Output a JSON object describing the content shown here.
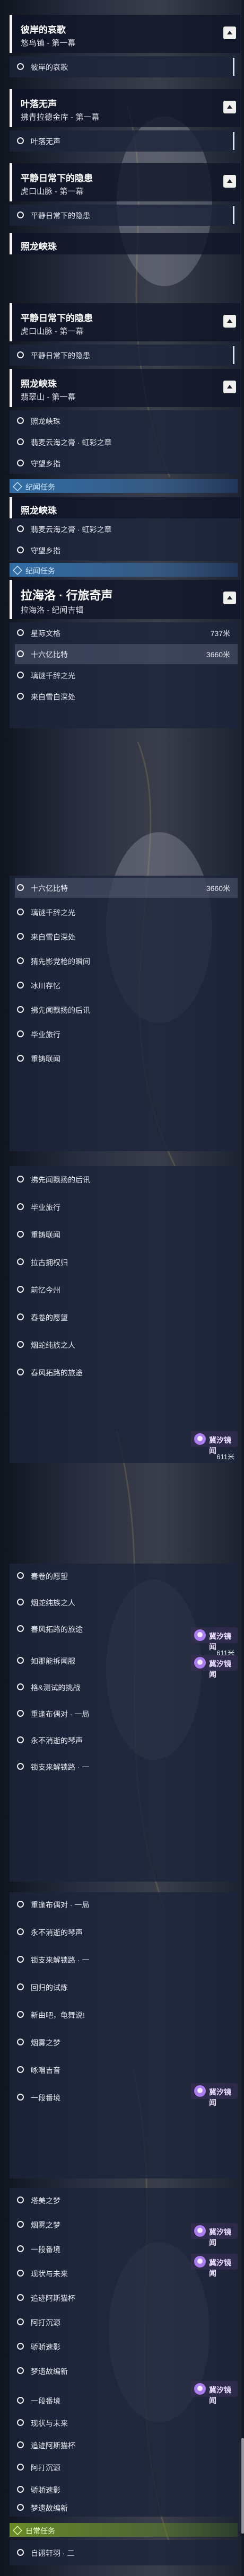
{
  "quests": {
    "q1": {
      "title": "彼岸的哀歌",
      "sub": "悠鸟镇 - 第一幕",
      "obj1": "彼岸的哀歌"
    },
    "q2": {
      "title": "叶落无声",
      "sub": "拂青拉德金库 - 第一幕",
      "obj1": "叶落无声"
    },
    "q3": {
      "title": "平静日常下的隐患",
      "sub": "虎口山脉 - 第一幕",
      "obj1": "平静日常下的隐患"
    },
    "q4": {
      "title": "照龙峡珠",
      "sub": "翡翠山 - 第一幕"
    },
    "q5": {
      "title": "拉海洛 · 行旅奇声",
      "sub": "拉海洛 - 纪闻吉辑"
    }
  },
  "sections": {
    "travel": "纪闻任务",
    "daily": "日常任务"
  },
  "objectives": {
    "zhaolong": "照龙峡珠",
    "feixia": "翡麦云海之膏 · 虹彩之章",
    "shouwang": "守望乡指",
    "xinglin": "星际文格",
    "shiliu": "十六亿比特",
    "liwo": "璃谜千辞之光",
    "laizi": "来自雪白深处",
    "jixian": "猜先影党枪的瞬间",
    "bingjing": "冰川存忆",
    "jiguang": "拂先闻飘扬的后讯",
    "bixian": "毕业旅行",
    "chongyin": "重铸联闻",
    "zhugu": "拂先闻飘扬的后讯",
    "bixian2": "毕业旅行",
    "chongyin2": "重铸联闻",
    "lagu": "拉古拥权归",
    "jiuyi": "前忆今州",
    "chunjuan": "春卷的愿望",
    "yinghuo": "烟蛇纯族之人",
    "chunfeng": "春风拓路的旅途",
    "chunjuan2": "春卷的愿望",
    "yinghuo2": "烟蛇纯族之人",
    "chunfeng2": "春风拓路的旅途",
    "jiedan": "如那能拆闻服",
    "ceshi": "格&测试的挑战",
    "zhongyi": "重逢布偶对 · 一局",
    "yongbu": "永不消逝的琴声",
    "zhengjin": "锁支来解锁路 · 一",
    "zhongyi2": "重逢布偶对 · 一局",
    "yongbu2": "永不消逝的琴声",
    "zhengjin2": "锁支来解锁路 · 一",
    "huixiang": "回归的试炼",
    "guiqi": "新由吧，龟舞说!",
    "yanmeng": "烟雾之梦",
    "tamei": "塔美之梦",
    "yiduan": "一段番境",
    "yanmeng2": "烟雾之梦",
    "yongqu": "咏唱吉音",
    "yiduan2": "一段番境",
    "xianshi": "现状与未来",
    "zhuiji": "追迹阿斯猫杯",
    "atong": "阿打沉源",
    "jiaoyang": "骄骄速影",
    "mengjing": "梦遗故编新",
    "yiduan3": "一段番境",
    "xianshi2": "现状与未来",
    "zhuiji2": "追迹阿斯猫杯",
    "atong2": "阿打沉源",
    "jiaoyang2": "骄骄速影",
    "mengjing2": "梦遗故编新",
    "zijing": "自诩轩羽 · 二"
  },
  "distances": {
    "d737": "737米",
    "d3660": "3660米",
    "d611": "611米"
  },
  "tracker": {
    "name": "冀汐镜闻"
  }
}
